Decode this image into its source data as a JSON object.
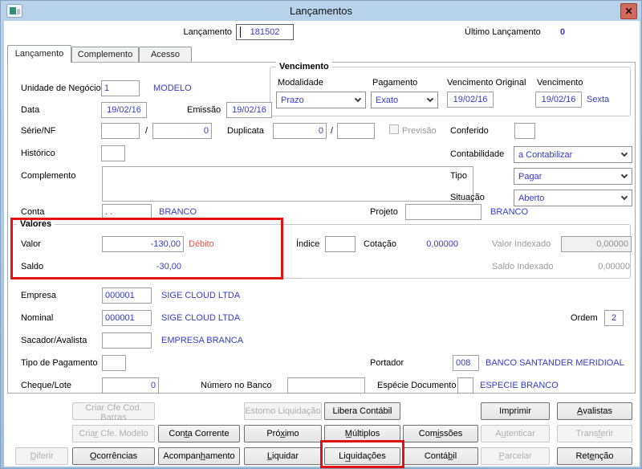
{
  "window": {
    "title": "Lançamentos",
    "close_glyph": "✕"
  },
  "header": {
    "lancamento_label": "Lançamento",
    "lancamento_value": "181502",
    "ultimo_label": "Último Lançamento",
    "ultimo_value": "0"
  },
  "tabs": {
    "lancamento": "Lançamento",
    "complemento": "Complemento",
    "acesso": "Acesso"
  },
  "form": {
    "unidade": {
      "label": "Unidade de Negócio",
      "value": "1",
      "desc": "MODELO"
    },
    "data": {
      "label": "Data",
      "value": "19/02/16"
    },
    "emissao": {
      "label": "Emissão",
      "value": "19/02/16"
    },
    "serie": {
      "label": "Série/NF",
      "value1": "",
      "sep": "/",
      "value2": "0"
    },
    "duplicata": {
      "label": "Duplicata",
      "value1": "0",
      "sep": "/",
      "value2": ""
    },
    "previsao": {
      "label": "Previsão"
    },
    "conferido": {
      "label": "Conferido",
      "value": ""
    },
    "historico": {
      "label": "Histórico",
      "value": ""
    },
    "contabilidade": {
      "label": "Contabilidade",
      "value": "a Contabilizar"
    },
    "complemento": {
      "label": "Complemento",
      "value": ""
    },
    "tipo": {
      "label": "Tipo",
      "value": "Pagar"
    },
    "situacao": {
      "label": "Situação",
      "value": "Aberto"
    },
    "conta": {
      "label": "Conta",
      "value": ". .",
      "desc": "BRANCO"
    },
    "projeto": {
      "label": "Projeto",
      "value": "",
      "desc": "BRANCO"
    },
    "empresa": {
      "label": "Empresa",
      "value": "000001",
      "desc": "SIGE CLOUD LTDA"
    },
    "nominal": {
      "label": "Nominal",
      "value": "000001",
      "desc": "SIGE CLOUD LTDA"
    },
    "ordem": {
      "label": "Ordem",
      "value": "2"
    },
    "sacador": {
      "label": "Sacador/Avalista",
      "value": "",
      "desc": "EMPRESA BRANCA"
    },
    "tipo_pagamento": {
      "label": "Tipo de Pagamento",
      "value": ""
    },
    "portador": {
      "label": "Portador",
      "value": "008",
      "desc": "BANCO SANTANDER MERIDIOAL"
    },
    "cheque": {
      "label": "Cheque/Lote",
      "value": "0"
    },
    "numero_banco": {
      "label": "Número no Banco",
      "value": ""
    },
    "especie": {
      "label": "Espécie Documento",
      "value": "",
      "desc": "ESPECIE BRANCO"
    }
  },
  "vencimento": {
    "title": "Vencimento",
    "modalidade": {
      "label": "Modalidade",
      "value": "Prazo"
    },
    "pagamento": {
      "label": "Pagamento",
      "value": "Exato"
    },
    "venc_original": {
      "label": "Vencimento Original",
      "value": "19/02/16"
    },
    "venc": {
      "label": "Vencimento",
      "value": "19/02/16",
      "weekday": "Sexta"
    }
  },
  "valores": {
    "title": "Valores",
    "valor": {
      "label": "Valor",
      "value": "-130,00",
      "tag": "Débito"
    },
    "saldo": {
      "label": "Saldo",
      "value": "-30,00"
    },
    "indice": {
      "label": "Índice",
      "value": ""
    },
    "cotacao": {
      "label": "Cotação",
      "value": "0,00000"
    },
    "valor_indexado": {
      "label": "Valor Indexado",
      "value": "0,00000"
    },
    "saldo_indexado": {
      "label": "Saldo Indexado",
      "value": "0,00000"
    }
  },
  "footer": {
    "criar_barras": "Criar Cfe Cod. Barras",
    "estorno_liquidacao": "Estorno Liquidação",
    "libera_contabil": "Libera Contábil",
    "imprimir": "Imprimir",
    "avalistas": "A̲valistas",
    "criar_modelo": "Criar̲ Cfe. Modelo",
    "conta_corrente": "Cont̲a Corrente",
    "proximo": "Próx̲imo",
    "multiplos": "M̲últiplos",
    "comissoes": "Comi̲ssões",
    "autenticar": "Au̲tenticar",
    "transferir": "Transf̲erir",
    "diferir": "D̲iferir",
    "ocorrencias": "O̲corrências",
    "acompanhamento": "Acompanh̲amento",
    "liquidar": "L̲iquidar",
    "liquidacoes": "Liq̲uidações",
    "contabil": "Contáb̲il",
    "parcelar": "P̲arcelar",
    "retencao": "Rete̲nção"
  },
  "colors": {
    "titlebar": "#aac7e3",
    "value_text": "#3a3ac8",
    "debit_red": "#e05050",
    "annotation_red": "#e01212"
  }
}
